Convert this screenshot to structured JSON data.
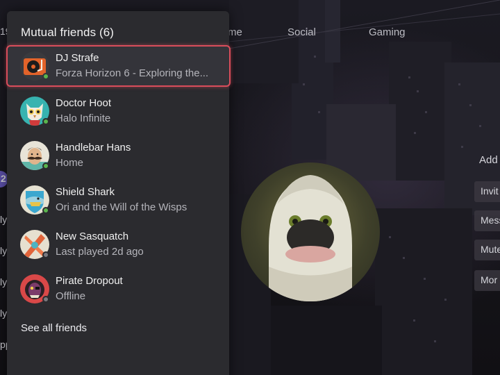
{
  "nav": {
    "tabs": [
      {
        "label": "me"
      },
      {
        "label": "Social"
      },
      {
        "label": "Gaming"
      }
    ]
  },
  "profile_actions": {
    "add": "Add",
    "invite": "Invit",
    "message": "Mess",
    "mute": "Mute",
    "more": "Mor"
  },
  "edge": {
    "top": "19",
    "r1": "2",
    "r2": "ly",
    "r3": "ly",
    "r4": "ly",
    "r5": "ly",
    "r6": "pp"
  },
  "mutual_friends": {
    "title": "Mutual friends (6)",
    "see_all_label": "See all friends",
    "friends": [
      {
        "name": "DJ Strafe",
        "status": "Forza Horizon 6 - Exploring the...",
        "presence": "online",
        "avatar_icon": "turntable-icon"
      },
      {
        "name": "Doctor Hoot",
        "status": "Halo Infinite",
        "presence": "online",
        "avatar_icon": "owl-icon"
      },
      {
        "name": "Handlebar Hans",
        "status": "Home",
        "presence": "online",
        "avatar_icon": "mustache-man-icon"
      },
      {
        "name": "Shield Shark",
        "status": "Ori and the Will of the Wisps",
        "presence": "online",
        "avatar_icon": "shark-icon"
      },
      {
        "name": "New Sasquatch",
        "status": "Last played 2d ago",
        "presence": "offline",
        "avatar_icon": "sasquatch-icon"
      },
      {
        "name": "Pirate Dropout",
        "status": "Offline",
        "presence": "offline",
        "avatar_icon": "pirate-icon"
      }
    ]
  },
  "colors": {
    "focus_border": "#d94d5b",
    "online": "#5ab54d",
    "offline": "#7a7a80"
  }
}
